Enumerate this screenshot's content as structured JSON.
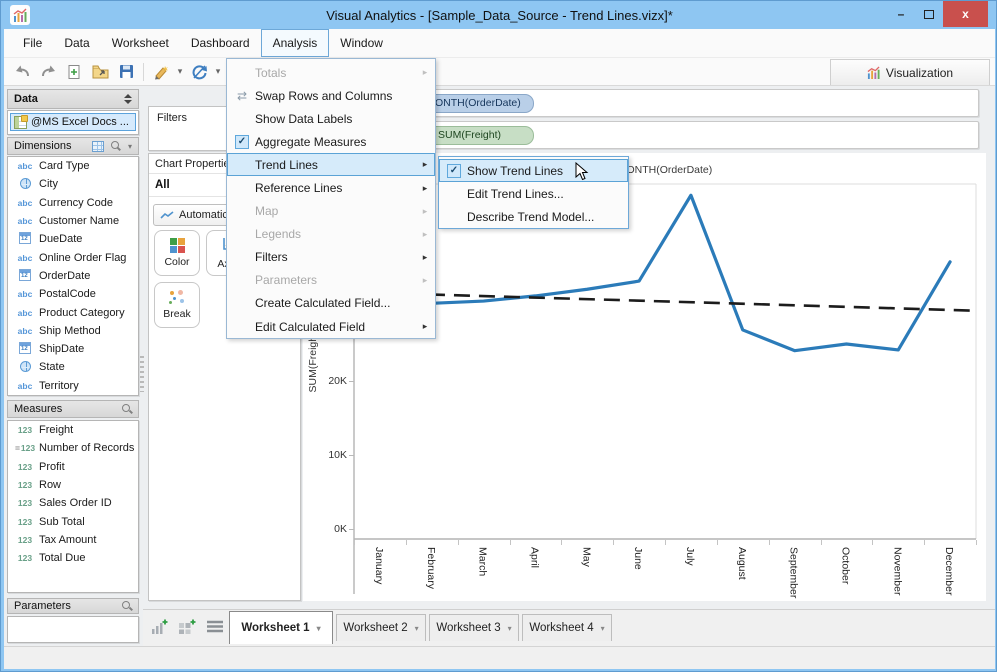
{
  "window": {
    "title": "Visual Analytics - [Sample_Data_Source - Trend Lines.vizx]*",
    "controls": {
      "minimize": "–",
      "close": "x"
    }
  },
  "menubar": {
    "items": [
      {
        "label": "File",
        "active": false
      },
      {
        "label": "Data",
        "active": false
      },
      {
        "label": "Worksheet",
        "active": false
      },
      {
        "label": "Dashboard",
        "active": false
      },
      {
        "label": "Analysis",
        "active": true
      },
      {
        "label": "Window",
        "active": false
      }
    ]
  },
  "toolbar": {
    "buttons": [
      "undo",
      "redo",
      "new-workbook",
      "open",
      "save",
      "highlighter",
      "refresh",
      "add-chart"
    ],
    "visualization_label": "Visualization"
  },
  "data_panel": {
    "header": "Data",
    "source": "@MS Excel Docs ...",
    "dimensions": {
      "header": "Dimensions",
      "items": [
        {
          "label": "Card Type",
          "icon": "abc"
        },
        {
          "label": "City",
          "icon": "globe"
        },
        {
          "label": "Currency Code",
          "icon": "abc"
        },
        {
          "label": "Customer Name",
          "icon": "abc"
        },
        {
          "label": "DueDate",
          "icon": "date"
        },
        {
          "label": "Online Order Flag",
          "icon": "abc"
        },
        {
          "label": "OrderDate",
          "icon": "date"
        },
        {
          "label": "PostalCode",
          "icon": "abc"
        },
        {
          "label": "Product Category",
          "icon": "abc"
        },
        {
          "label": "Ship Method",
          "icon": "abc"
        },
        {
          "label": "ShipDate",
          "icon": "date"
        },
        {
          "label": "State",
          "icon": "globe"
        },
        {
          "label": "Territory",
          "icon": "abc"
        }
      ]
    },
    "measures": {
      "header": "Measures",
      "items": [
        {
          "label": "Freight",
          "icon": "123"
        },
        {
          "label": "Number of Records",
          "icon": "calc123"
        },
        {
          "label": "Profit",
          "icon": "123"
        },
        {
          "label": "Row",
          "icon": "123"
        },
        {
          "label": "Sales Order ID",
          "icon": "123"
        },
        {
          "label": "Sub Total",
          "icon": "123"
        },
        {
          "label": "Tax Amount",
          "icon": "123"
        },
        {
          "label": "Total Due",
          "icon": "123"
        }
      ]
    },
    "parameters": {
      "header": "Parameters"
    }
  },
  "filters_shelf": {
    "label": "Filters"
  },
  "chart_properties": {
    "header": "Chart Properties",
    "group": "All",
    "mark_type": "Automatic",
    "buttons": [
      "Color",
      "Axes",
      "Break"
    ]
  },
  "shelves": {
    "columns_pill": "MONTH(OrderDate)",
    "rows_pill": "SUM(Freight)"
  },
  "analysis_menu": {
    "items": [
      {
        "label": "Totals",
        "disabled": true,
        "submenu": true,
        "checked": false,
        "highlighted": false,
        "icon": ""
      },
      {
        "label": "Swap Rows and Columns",
        "disabled": false,
        "submenu": false,
        "checked": false,
        "highlighted": false,
        "icon": "swap"
      },
      {
        "label": "Show Data Labels",
        "disabled": false,
        "submenu": false,
        "checked": false,
        "highlighted": false,
        "icon": ""
      },
      {
        "label": "Aggregate Measures",
        "disabled": false,
        "submenu": false,
        "checked": true,
        "highlighted": false,
        "icon": ""
      },
      {
        "label": "Trend Lines",
        "disabled": false,
        "submenu": true,
        "checked": false,
        "highlighted": true,
        "icon": ""
      },
      {
        "label": "Reference Lines",
        "disabled": false,
        "submenu": true,
        "checked": false,
        "highlighted": false,
        "icon": ""
      },
      {
        "label": "Map",
        "disabled": true,
        "submenu": true,
        "checked": false,
        "highlighted": false,
        "icon": ""
      },
      {
        "label": "Legends",
        "disabled": true,
        "submenu": true,
        "checked": false,
        "highlighted": false,
        "icon": ""
      },
      {
        "label": "Filters",
        "disabled": false,
        "submenu": true,
        "checked": false,
        "highlighted": false,
        "icon": ""
      },
      {
        "label": "Parameters",
        "disabled": true,
        "submenu": true,
        "checked": false,
        "highlighted": false,
        "icon": ""
      },
      {
        "label": "Create Calculated Field...",
        "disabled": false,
        "submenu": false,
        "checked": false,
        "highlighted": false,
        "icon": ""
      },
      {
        "label": "Edit Calculated Field",
        "disabled": false,
        "submenu": true,
        "checked": false,
        "highlighted": false,
        "icon": ""
      }
    ]
  },
  "trend_submenu": {
    "items": [
      {
        "label": "Show Trend Lines",
        "checked": true,
        "highlighted": true
      },
      {
        "label": "Edit Trend Lines...",
        "checked": false,
        "highlighted": false
      },
      {
        "label": "Describe Trend Model...",
        "checked": false,
        "highlighted": false
      }
    ]
  },
  "worksheet_tabs": {
    "tabs": [
      "Worksheet 1",
      "Worksheet 2",
      "Worksheet 3",
      "Worksheet 4"
    ],
    "active": "Worksheet 1"
  },
  "chart_data": {
    "type": "line",
    "title": "MONTH(OrderDate)",
    "categories": [
      "January",
      "February",
      "March",
      "April",
      "May",
      "June",
      "July",
      "August",
      "September",
      "October",
      "November",
      "December"
    ],
    "ylabel": "SUM(Freight)",
    "yticks": [
      {
        "label": "0K",
        "value": 0
      },
      {
        "label": "10K",
        "value": 10000
      },
      {
        "label": "20K",
        "value": 20000
      }
    ],
    "ylim": [
      0,
      50000
    ],
    "grid": false,
    "legend_position": "none",
    "series": [
      {
        "name": "SUM(Freight)",
        "type": "line",
        "color": "#2b7bb9",
        "values": [
          30800,
          30500,
          30800,
          31500,
          32400,
          33500,
          45100,
          26900,
          24100,
          25000,
          24200,
          36100
        ]
      },
      {
        "name": "Trend Line",
        "type": "trend",
        "style": "dashed",
        "color": "#1c1c1c",
        "start_value": 32000,
        "end_value": 29500
      }
    ]
  },
  "colors": {
    "titlebar": "#8ec6f2",
    "close_button": "#c9504d",
    "menu_highlight": "#d6ebfa",
    "pill_columns": "#b9cfe8",
    "pill_rows": "#c7dec5",
    "line": "#2b7bb9",
    "trend": "#1c1c1c"
  }
}
